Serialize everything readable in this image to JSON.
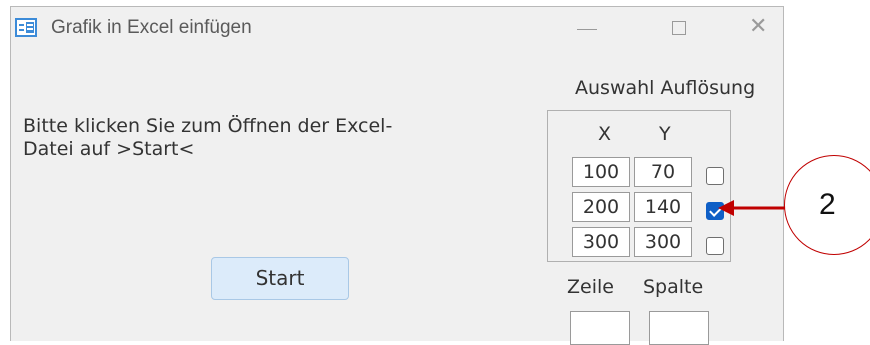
{
  "window": {
    "title": "Grafik in Excel einfügen",
    "icon": "access-form-icon",
    "controls": [
      "minimize-icon",
      "maximize-icon",
      "close-icon"
    ]
  },
  "main": {
    "instruction_line1": "Bitte klicken Sie zum Öffnen der Excel-",
    "instruction_line2": "Datei auf >Start<",
    "start_label": "Start"
  },
  "resolution": {
    "title": "Auswahl Auflösung",
    "col_x": "X",
    "col_y": "Y",
    "rows": [
      {
        "x": "100",
        "y": "70",
        "checked": false
      },
      {
        "x": "200",
        "y": "140",
        "checked": true
      },
      {
        "x": "300",
        "y": "300",
        "checked": false
      }
    ]
  },
  "cell_labels": {
    "zeile": "Zeile",
    "spalte": "Spalte"
  },
  "callout": {
    "number": "2",
    "color": "#c00000"
  },
  "colors": {
    "window_bg": "#f0f0f0",
    "checkbox_checked": "#0f5fc6",
    "start_button_bg": "#dcebfa"
  }
}
